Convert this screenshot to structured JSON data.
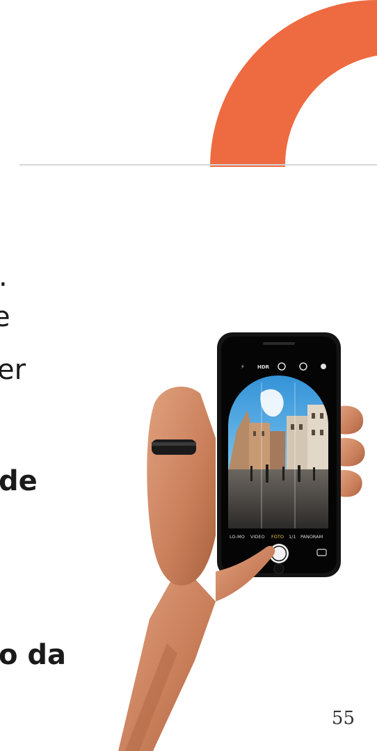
{
  "body_text": {
    "line1": ".",
    "line2": "e",
    "line3": "er",
    "line4": "de",
    "line5": "o da"
  },
  "photo": {
    "camera_modes": [
      "LO-MO",
      "VIDEO",
      "FOTO",
      "1/1",
      "PANORAM"
    ],
    "camera_top": [
      "HDR"
    ]
  },
  "page_number": "55",
  "colors": {
    "accent_orange": "#ee6a40",
    "rule_gray": "#d6d6d6",
    "text": "#1a1a1a"
  }
}
